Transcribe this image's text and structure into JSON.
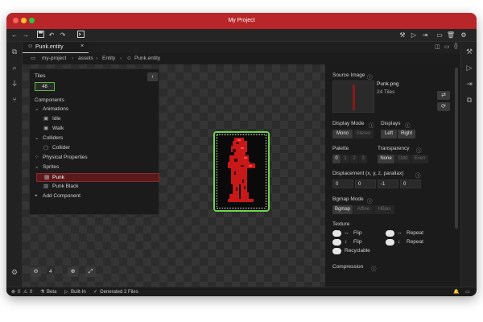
{
  "window": {
    "title": "My Project"
  },
  "tab": {
    "label": "Punk.entity"
  },
  "breadcrumb": [
    "my-project",
    "assets",
    "Entity",
    "Punk.entity"
  ],
  "tiles": {
    "label": "Tiles",
    "value": "48"
  },
  "tree": {
    "components_label": "Components",
    "items": [
      {
        "label": "Animations",
        "depth": 0,
        "kind": "group"
      },
      {
        "label": "Idle",
        "depth": 1,
        "kind": "anim"
      },
      {
        "label": "Walk",
        "depth": 1,
        "kind": "anim"
      },
      {
        "label": "Colliders",
        "depth": 0,
        "kind": "group"
      },
      {
        "label": "Collider",
        "depth": 1,
        "kind": "collider"
      },
      {
        "label": "Physical Properties",
        "depth": 0,
        "kind": "phys"
      },
      {
        "label": "Sprites",
        "depth": 0,
        "kind": "group"
      },
      {
        "label": "Punk",
        "depth": 1,
        "kind": "sprite",
        "selected": true
      },
      {
        "label": "Punk Black",
        "depth": 1,
        "kind": "sprite"
      }
    ],
    "add_label": "Add Component"
  },
  "zoom": {
    "value": "4"
  },
  "props": {
    "source_image_label": "Source Image",
    "source_name": "Punk.png",
    "source_tiles": "24 Tiles",
    "display_mode_label": "Display Mode",
    "display_mode_options": [
      "Mono",
      "Stereo"
    ],
    "displays_label": "Displays",
    "displays_options": [
      "Left",
      "Right"
    ],
    "palette_label": "Palette",
    "palette_options": [
      "0",
      "1",
      "2",
      "3"
    ],
    "transparency_label": "Transparency",
    "transparency_options": [
      "None",
      "Odd",
      "Even"
    ],
    "displacement_label": "Displacement (x, y, z, parallax)",
    "displacement_values": [
      "0",
      "0",
      "-1",
      "0"
    ],
    "bgmap_label": "Bgmap Mode",
    "bgmap_options": [
      "Bgmap",
      "Affine",
      "HBias"
    ],
    "texture_label": "Texture",
    "texture_flip_h": "Flip",
    "texture_flip_v": "Flip",
    "texture_recyclable": "Recyclable",
    "texture_repeat_h": "Repeat",
    "texture_repeat_v": "Repeat",
    "compression_label": "Compression"
  },
  "palette_swatches": [
    "#000000",
    "#4a0a0a",
    "#a01818",
    "#ff2a2a"
  ],
  "status": {
    "errors": "0",
    "warnings": "0",
    "beta": "Beta",
    "builtin": "Built-In",
    "generated": "Generated 2 Files"
  },
  "colors": {
    "titlebar": "#b8262a",
    "selection": "#5a1a1c",
    "sprite_border": "#6cd64a",
    "sprite_red": "#c81818"
  }
}
